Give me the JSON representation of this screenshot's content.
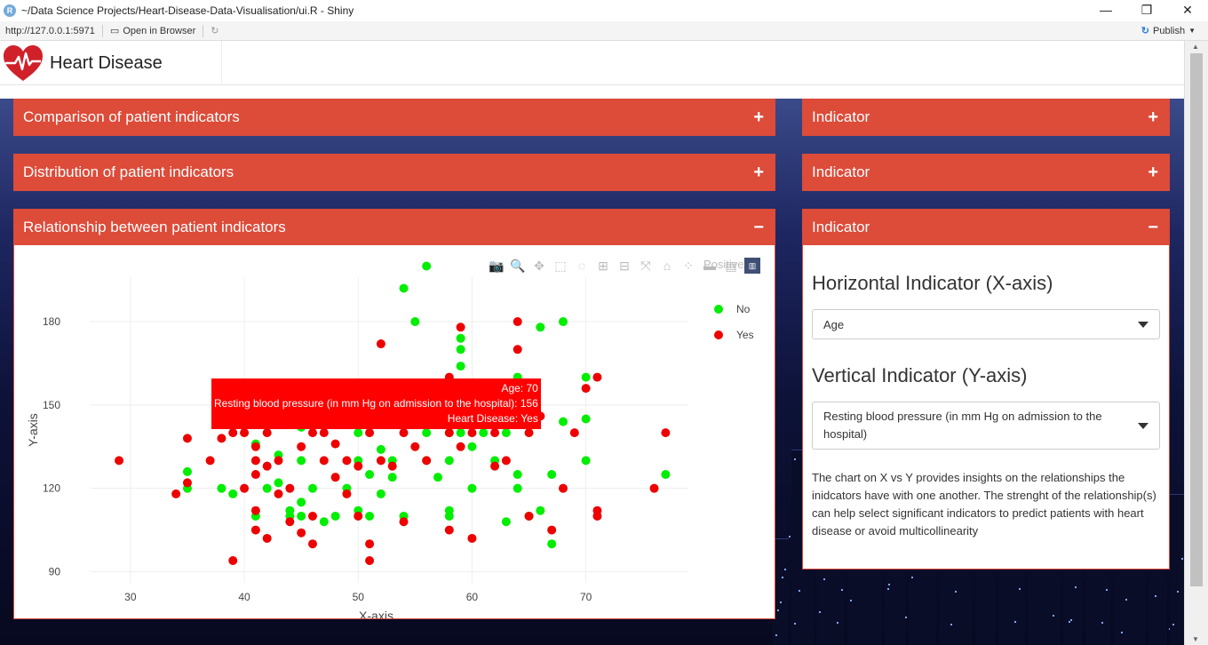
{
  "window": {
    "title": "~/Data Science Projects/Heart-Disease-Data-Visualisation/ui.R - Shiny",
    "url": "http://127.0.0.1:5971",
    "open_in_browser": "Open in Browser",
    "publish": "Publish"
  },
  "header": {
    "title": "Heart Disease"
  },
  "boxes": {
    "comparison": "Comparison of patient indicators",
    "distribution": "Distribution of patient indicators",
    "relationship": "Relationship between patient indicators",
    "indicator1": "Indicator",
    "indicator2": "Indicator",
    "indicator3": "Indicator",
    "plus": "+",
    "minus": "−"
  },
  "form": {
    "x_label": "Horizontal Indicator (X-axis)",
    "x_value": "Age",
    "y_label": "Vertical Indicator (Y-axis)",
    "y_value": "Resting blood pressure (in mm Hg on admission to the hospital)",
    "help": "The chart on X vs Y provides insights on the relationships the inidcators have with one another. The strenght of the relationship(s) can help select significant indicators to predict patients with heart disease or avoid multicollinearity"
  },
  "colors": {
    "accent": "#dd4b39",
    "no": "#00ee00",
    "yes": "#ee0000"
  },
  "tooltip": {
    "line1": "Age: 70",
    "line2": "Resting blood pressure (in mm Hg on admission to the hospital): 156",
    "line3": "Heart Disease: Yes"
  },
  "chart_data": {
    "type": "scatter",
    "xlabel": "X-axis",
    "ylabel": "Y-axis",
    "xlim": [
      26.5,
      79
    ],
    "ylim": [
      86,
      196
    ],
    "xticks": [
      30,
      40,
      50,
      60,
      70
    ],
    "yticks": [
      90,
      120,
      150,
      180
    ],
    "legend": {
      "placement": "top-right",
      "faded_label": "Positive"
    },
    "series": [
      {
        "name": "No",
        "color": "#00ee00",
        "points": [
          [
            35,
            126
          ],
          [
            35,
            120
          ],
          [
            38,
            120
          ],
          [
            39,
            118
          ],
          [
            41,
            110
          ],
          [
            41,
            136
          ],
          [
            42,
            120
          ],
          [
            43,
            132
          ],
          [
            43,
            122
          ],
          [
            44,
            112
          ],
          [
            44,
            110
          ],
          [
            45,
            142
          ],
          [
            45,
            130
          ],
          [
            45,
            115
          ],
          [
            45,
            110
          ],
          [
            46,
            120
          ],
          [
            46,
            144
          ],
          [
            47,
            108
          ],
          [
            48,
            110
          ],
          [
            49,
            120
          ],
          [
            50,
            140
          ],
          [
            50,
            144
          ],
          [
            50,
            130
          ],
          [
            50,
            112
          ],
          [
            51,
            125
          ],
          [
            51,
            110
          ],
          [
            52,
            118
          ],
          [
            52,
            134
          ],
          [
            53,
            130
          ],
          [
            53,
            124
          ],
          [
            54,
            110
          ],
          [
            54,
            192
          ],
          [
            55,
            180
          ],
          [
            56,
            200
          ],
          [
            56,
            130
          ],
          [
            56,
            140
          ],
          [
            57,
            124
          ],
          [
            57,
            150
          ],
          [
            58,
            140
          ],
          [
            58,
            110
          ],
          [
            58,
            130
          ],
          [
            58,
            112
          ],
          [
            59,
            164
          ],
          [
            59,
            170
          ],
          [
            59,
            174
          ],
          [
            59,
            140
          ],
          [
            60,
            120
          ],
          [
            60,
            135
          ],
          [
            61,
            140
          ],
          [
            61,
            145
          ],
          [
            62,
            130
          ],
          [
            62,
            150
          ],
          [
            63,
            108
          ],
          [
            63,
            140
          ],
          [
            63,
            150
          ],
          [
            64,
            160
          ],
          [
            64,
            125
          ],
          [
            64,
            120
          ],
          [
            65,
            110
          ],
          [
            65,
            155
          ],
          [
            66,
            178
          ],
          [
            66,
            112
          ],
          [
            67,
            125
          ],
          [
            67,
            100
          ],
          [
            68,
            180
          ],
          [
            68,
            144
          ],
          [
            70,
            145
          ],
          [
            70,
            160
          ],
          [
            70,
            130
          ],
          [
            77,
            125
          ]
        ]
      },
      {
        "name": "Yes",
        "color": "#ee0000",
        "points": [
          [
            29,
            130
          ],
          [
            34,
            118
          ],
          [
            35,
            122
          ],
          [
            35,
            138
          ],
          [
            37,
            130
          ],
          [
            38,
            138
          ],
          [
            39,
            140
          ],
          [
            39,
            94
          ],
          [
            40,
            140
          ],
          [
            40,
            120
          ],
          [
            41,
            130
          ],
          [
            41,
            135
          ],
          [
            41,
            125
          ],
          [
            41,
            112
          ],
          [
            41,
            105
          ],
          [
            42,
            102
          ],
          [
            42,
            140
          ],
          [
            42,
            128
          ],
          [
            43,
            118
          ],
          [
            43,
            130
          ],
          [
            44,
            120
          ],
          [
            44,
            108
          ],
          [
            45,
            135
          ],
          [
            45,
            104
          ],
          [
            46,
            140
          ],
          [
            46,
            110
          ],
          [
            46,
            100
          ],
          [
            47,
            130
          ],
          [
            47,
            140
          ],
          [
            48,
            136
          ],
          [
            48,
            124
          ],
          [
            49,
            130
          ],
          [
            49,
            118
          ],
          [
            50,
            128
          ],
          [
            50,
            110
          ],
          [
            51,
            100
          ],
          [
            51,
            94
          ],
          [
            51,
            140
          ],
          [
            52,
            172
          ],
          [
            52,
            130
          ],
          [
            53,
            128
          ],
          [
            54,
            140
          ],
          [
            54,
            108
          ],
          [
            55,
            135
          ],
          [
            56,
            130
          ],
          [
            57,
            150
          ],
          [
            58,
            160
          ],
          [
            58,
            105
          ],
          [
            58,
            140
          ],
          [
            59,
            178
          ],
          [
            59,
            135
          ],
          [
            60,
            102
          ],
          [
            60,
            140
          ],
          [
            61,
            150
          ],
          [
            62,
            128
          ],
          [
            62,
            140
          ],
          [
            63,
            130
          ],
          [
            64,
            180
          ],
          [
            64,
            170
          ],
          [
            65,
            140
          ],
          [
            65,
            110
          ],
          [
            66,
            146
          ],
          [
            67,
            105
          ],
          [
            68,
            120
          ],
          [
            69,
            140
          ],
          [
            70,
            156
          ],
          [
            71,
            160
          ],
          [
            71,
            110
          ],
          [
            71,
            112
          ],
          [
            76,
            120
          ],
          [
            77,
            140
          ]
        ]
      }
    ]
  }
}
